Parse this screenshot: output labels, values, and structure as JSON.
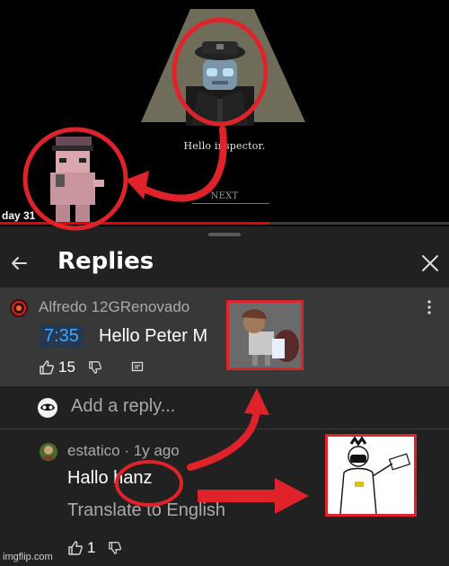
{
  "video": {
    "dialog_line": "Hello inspector.",
    "next_label": "NEXT",
    "day_label": "day 31",
    "progress_fraction": 0.6
  },
  "replies": {
    "title": "Replies",
    "parent_comment": {
      "author": "Alfredo 12GRenovado",
      "timestamp_chip": "7:35",
      "text": "Hello Peter M",
      "like_count": "15"
    },
    "add_reply_placeholder": "Add a reply...",
    "reply": {
      "author": "estatico",
      "age": "1y ago",
      "text": "Hallo hanz",
      "translate_label": "Translate to English",
      "like_count": "1"
    }
  },
  "colors": {
    "annotation_red": "#e0232a",
    "timestamp_blue": "#3ea6ff",
    "panel_bg": "#212121",
    "highlight_row_bg": "#383838"
  },
  "watermark": "imgflip.com"
}
